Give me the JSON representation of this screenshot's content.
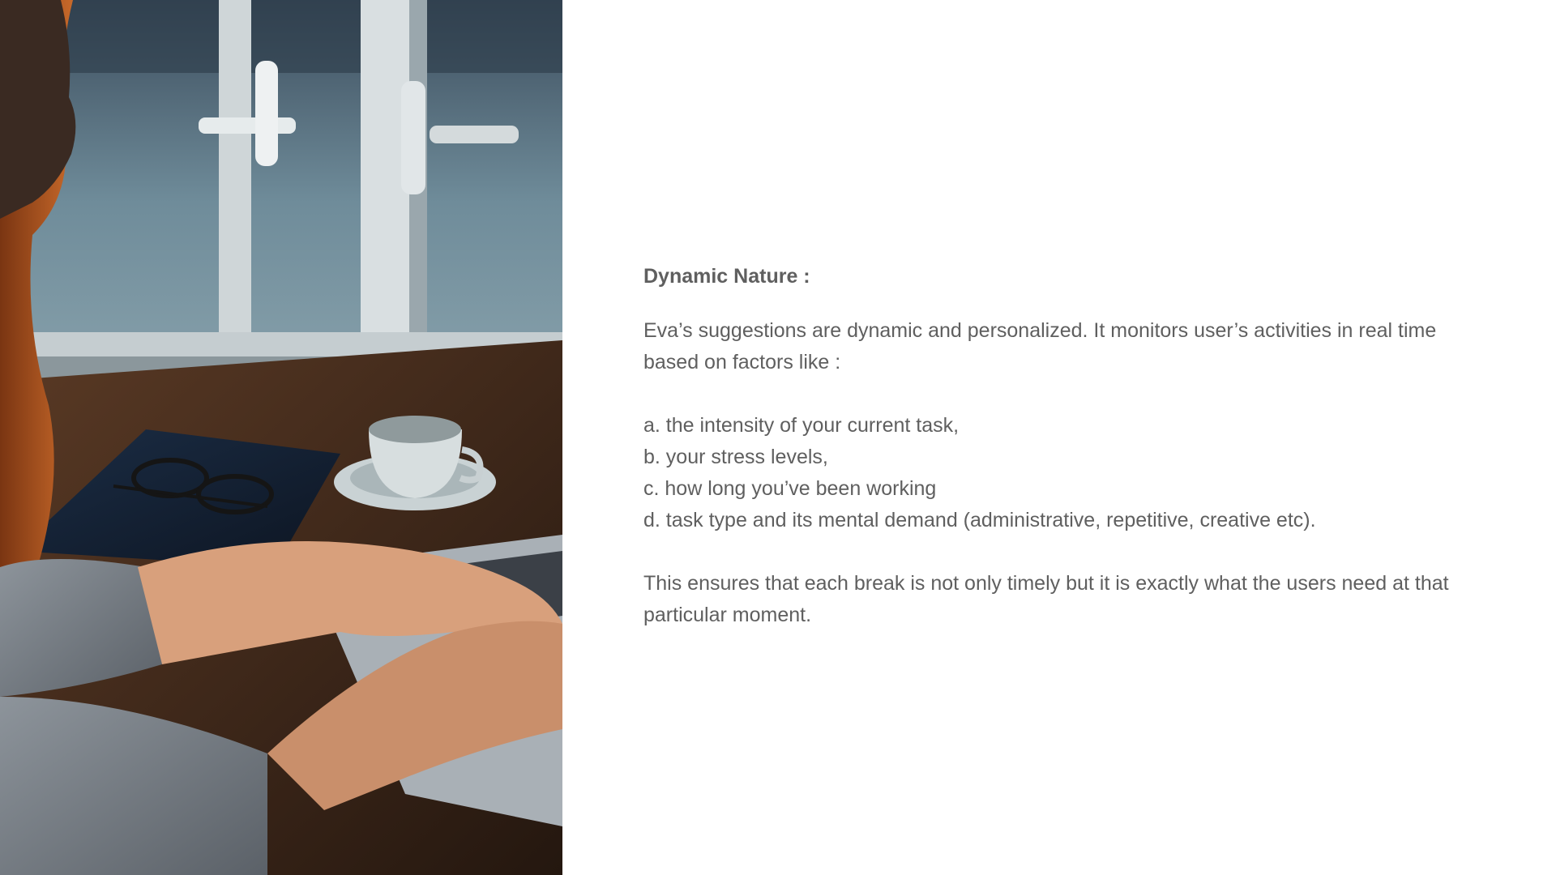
{
  "slide": {
    "image": {
      "description_icon": "photo-woman-laptop-coffee"
    },
    "heading": "Dynamic Nature :",
    "intro": "Eva’s suggestions are dynamic and personalized. It monitors user’s activities in real time based on factors like :",
    "factors": [
      "a. the intensity of your current task,",
      "b. your stress levels,",
      "c. how long you’ve been working",
      "d. task type and its mental demand (administrative, repetitive, creative etc)."
    ],
    "conclusion": "This ensures that each break is not only timely but it is exactly what the users need at that particular moment.",
    "colors": {
      "text": "#5f5f5f",
      "background": "#ffffff"
    }
  }
}
